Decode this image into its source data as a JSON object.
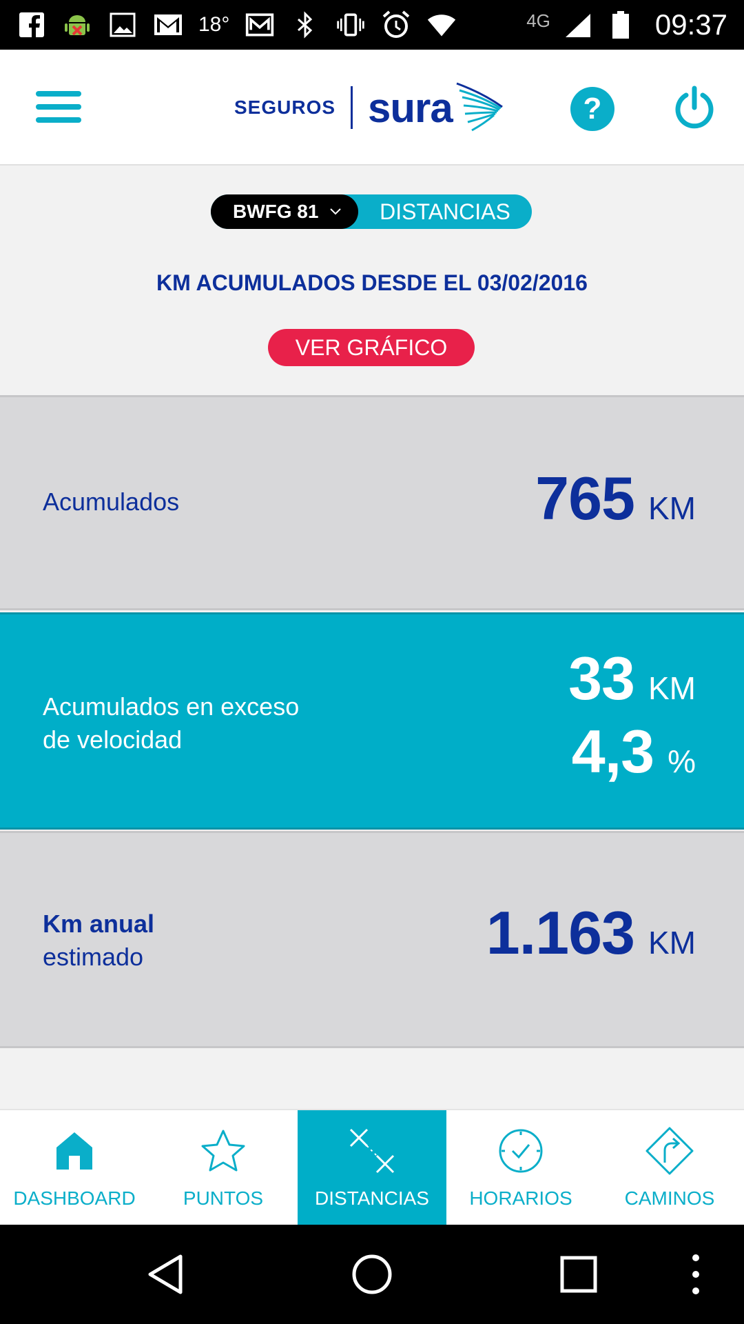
{
  "status_bar": {
    "temperature": "18°",
    "network": "4G",
    "time": "09:37"
  },
  "header": {
    "logo_seguros": "SEGUROS",
    "logo_sura": "sura",
    "help_label": "?"
  },
  "selector": {
    "plate": "BWFG 81",
    "section": "DISTANCIAS"
  },
  "since_text": "KM ACUMULADOS DESDE EL 03/02/2016",
  "graph_button": "VER GRÁFICO",
  "stats": {
    "accumulated": {
      "label": "Acumulados",
      "value": "765",
      "unit": "KM"
    },
    "speeding": {
      "label_line1": "Acumulados en exceso",
      "label_line2": "de velocidad",
      "km_value": "33",
      "km_unit": "KM",
      "pct_value": "4,3",
      "pct_unit": "%"
    },
    "annual": {
      "label_line1": "Km anual",
      "label_line2": "estimado",
      "value": "1.163",
      "unit": "KM"
    }
  },
  "nav": [
    {
      "label": "DASHBOARD",
      "icon": "home-icon"
    },
    {
      "label": "PUNTOS",
      "icon": "star-icon"
    },
    {
      "label": "DISTANCIAS",
      "icon": "distance-icon",
      "active": true
    },
    {
      "label": "HORARIOS",
      "icon": "clock-icon"
    },
    {
      "label": "CAMINOS",
      "icon": "route-icon"
    }
  ],
  "colors": {
    "accent": "#00aec8",
    "brand_blue": "#0d2f9b",
    "cta_red": "#e8214a"
  }
}
